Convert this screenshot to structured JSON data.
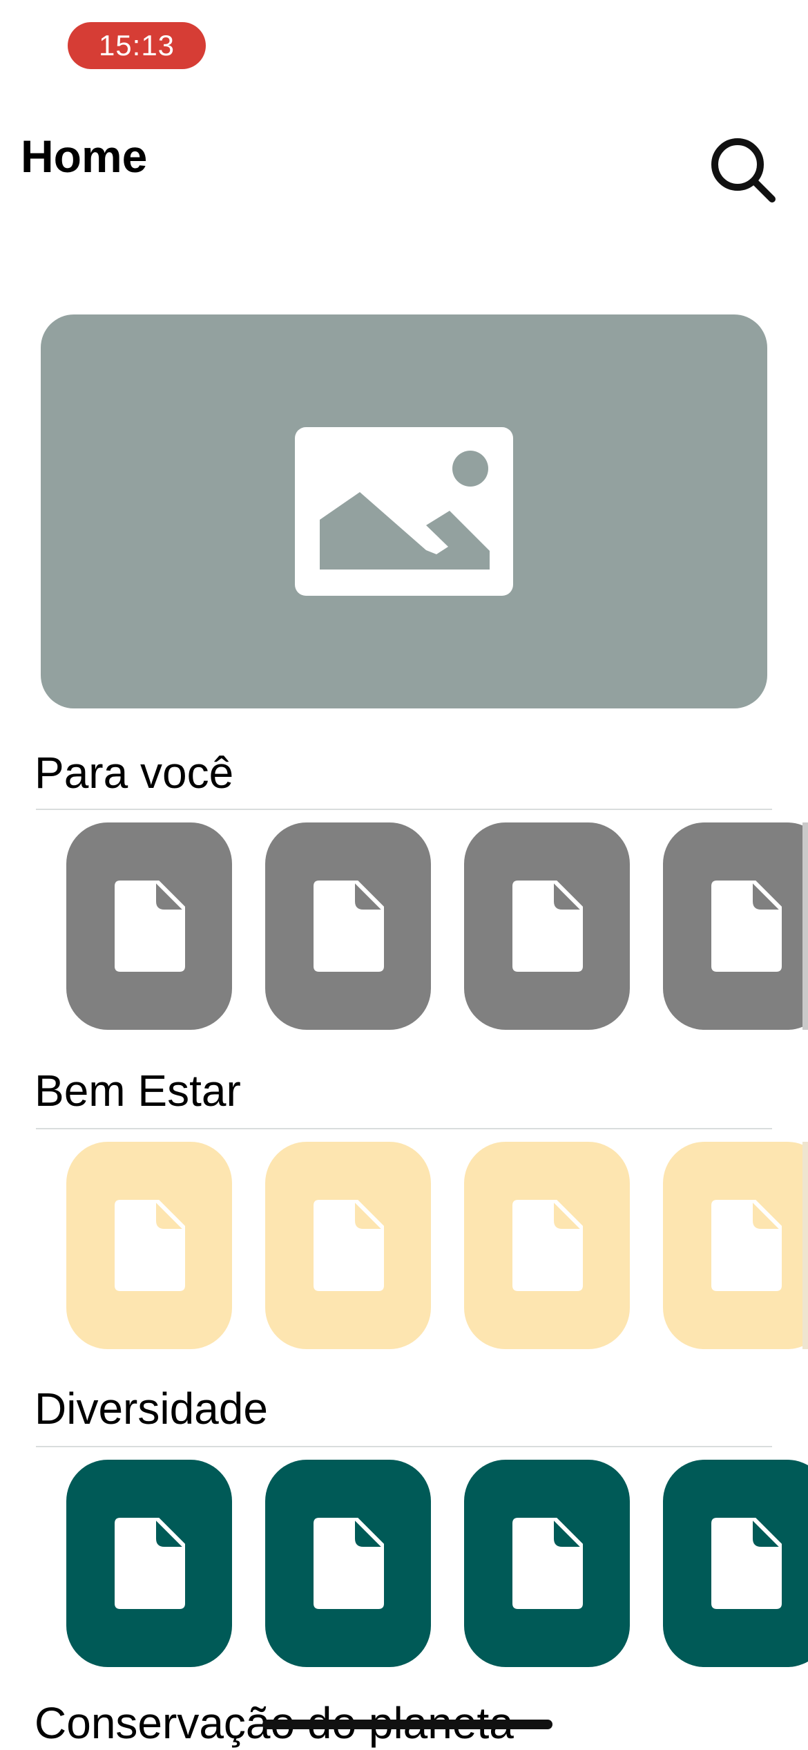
{
  "status_bar": {
    "time": "15:13"
  },
  "header": {
    "title": "Home",
    "search_icon": "search-icon"
  },
  "hero": {
    "icon": "image-placeholder-icon",
    "background_color": "#93a19f"
  },
  "sections": [
    {
      "title": "Para você",
      "card_color": "#808080",
      "card_icon": "document-icon",
      "visible_cards": 4
    },
    {
      "title": "Bem Estar",
      "card_color": "#fde5b0",
      "card_icon": "document-icon",
      "visible_cards": 4
    },
    {
      "title": "Diversidade",
      "card_color": "#005a57",
      "card_icon": "document-icon",
      "visible_cards": 4
    },
    {
      "title": "Conservação do planeta"
    }
  ]
}
